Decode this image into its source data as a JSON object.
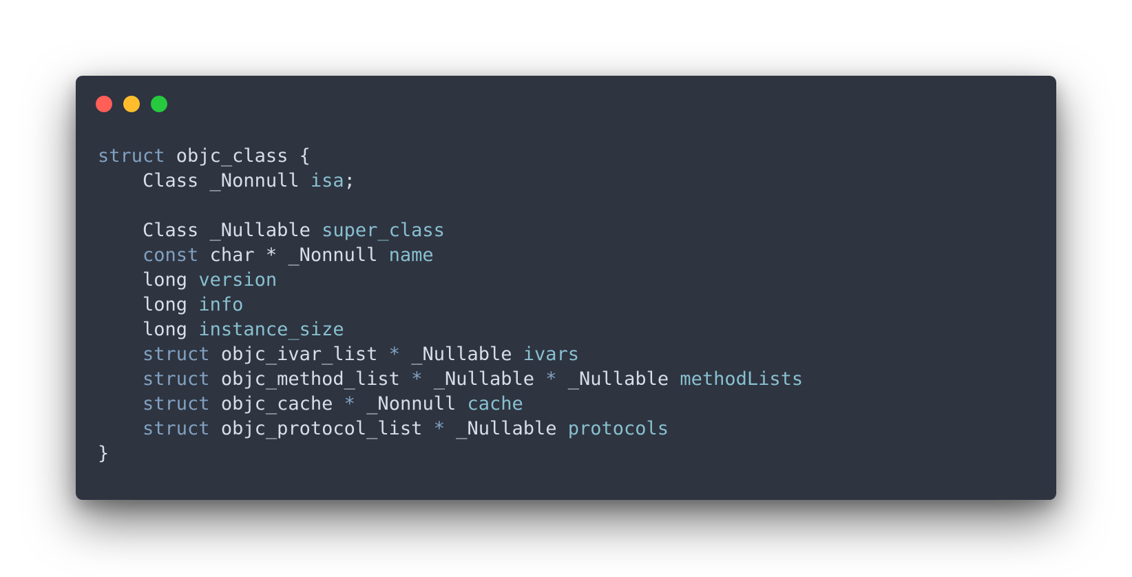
{
  "window": {
    "background": "#2e3440",
    "buttons": [
      {
        "name": "close",
        "color": "#ff5f56"
      },
      {
        "name": "minimize",
        "color": "#ffbd2e"
      },
      {
        "name": "zoom",
        "color": "#27c93f"
      }
    ]
  },
  "colors": {
    "keyword": "#81a1c1",
    "plain": "#d8dee9",
    "identifier": "#88c0d0"
  },
  "code_lines": [
    [
      {
        "t": "kw",
        "v": "struct"
      },
      {
        "t": "plain",
        "v": " objc_class {"
      }
    ],
    [
      {
        "t": "plain",
        "v": "    Class _Nonnull "
      },
      {
        "t": "name",
        "v": "isa"
      },
      {
        "t": "plain",
        "v": ";"
      }
    ],
    [],
    [
      {
        "t": "plain",
        "v": "    Class _Nullable "
      },
      {
        "t": "name",
        "v": "super_class"
      }
    ],
    [
      {
        "t": "plain",
        "v": "    "
      },
      {
        "t": "kw",
        "v": "const"
      },
      {
        "t": "plain",
        "v": " char * _Nonnull "
      },
      {
        "t": "name",
        "v": "name"
      }
    ],
    [
      {
        "t": "plain",
        "v": "    long "
      },
      {
        "t": "name",
        "v": "version"
      }
    ],
    [
      {
        "t": "plain",
        "v": "    long "
      },
      {
        "t": "name",
        "v": "info"
      }
    ],
    [
      {
        "t": "plain",
        "v": "    long "
      },
      {
        "t": "name",
        "v": "instance_size"
      }
    ],
    [
      {
        "t": "plain",
        "v": "    "
      },
      {
        "t": "kw",
        "v": "struct"
      },
      {
        "t": "plain",
        "v": " objc_ivar_list "
      },
      {
        "t": "op",
        "v": "*"
      },
      {
        "t": "plain",
        "v": " _Nullable "
      },
      {
        "t": "name",
        "v": "ivars"
      }
    ],
    [
      {
        "t": "plain",
        "v": "    "
      },
      {
        "t": "kw",
        "v": "struct"
      },
      {
        "t": "plain",
        "v": " objc_method_list "
      },
      {
        "t": "op",
        "v": "*"
      },
      {
        "t": "plain",
        "v": " _Nullable "
      },
      {
        "t": "op",
        "v": "*"
      },
      {
        "t": "plain",
        "v": " _Nullable "
      },
      {
        "t": "name",
        "v": "methodLists"
      }
    ],
    [
      {
        "t": "plain",
        "v": "    "
      },
      {
        "t": "kw",
        "v": "struct"
      },
      {
        "t": "plain",
        "v": " objc_cache "
      },
      {
        "t": "op",
        "v": "*"
      },
      {
        "t": "plain",
        "v": " _Nonnull "
      },
      {
        "t": "name",
        "v": "cache"
      }
    ],
    [
      {
        "t": "plain",
        "v": "    "
      },
      {
        "t": "kw",
        "v": "struct"
      },
      {
        "t": "plain",
        "v": " objc_protocol_list "
      },
      {
        "t": "op",
        "v": "*"
      },
      {
        "t": "plain",
        "v": " _Nullable "
      },
      {
        "t": "name",
        "v": "protocols"
      }
    ],
    [
      {
        "t": "plain",
        "v": "}"
      }
    ]
  ]
}
